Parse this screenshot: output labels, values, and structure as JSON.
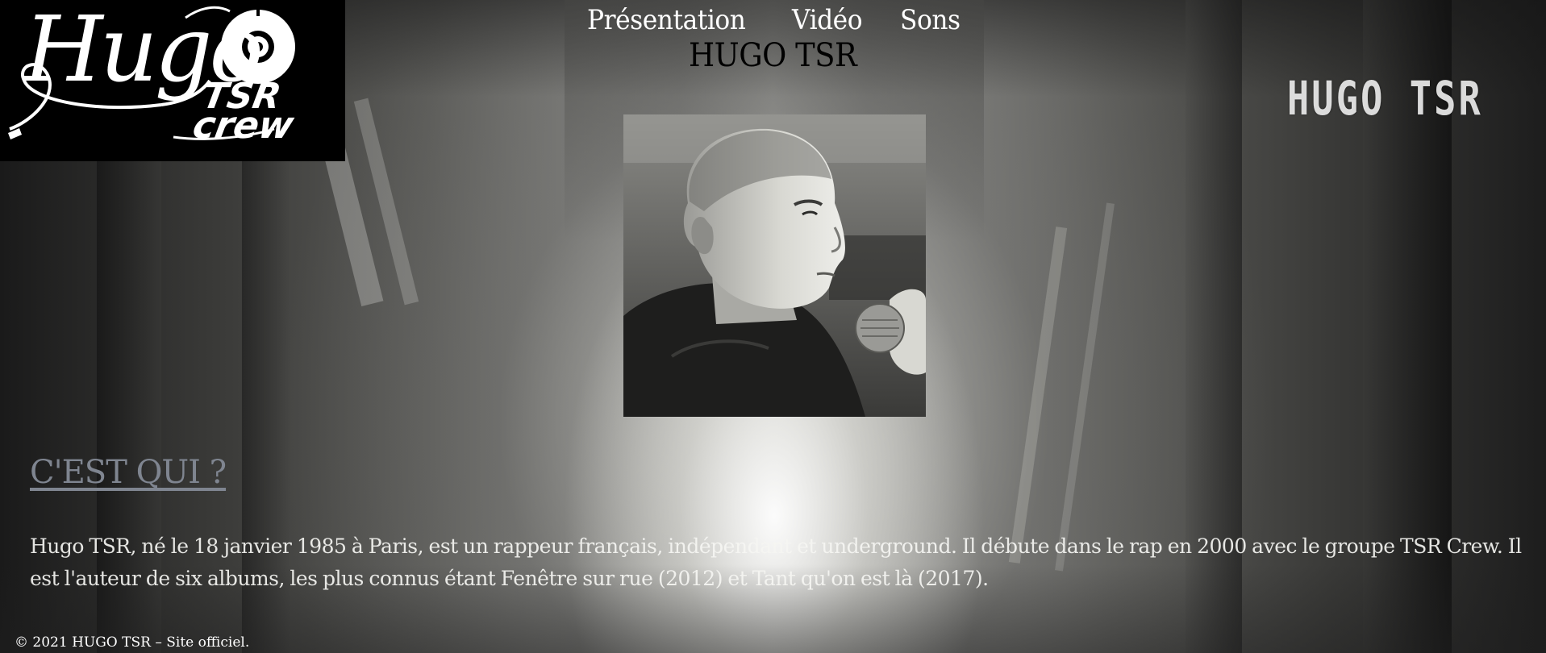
{
  "logo": {
    "line1": "Hugo",
    "line2": "TSR",
    "line3": "crew"
  },
  "nav": {
    "items": [
      {
        "label": "Présentation"
      },
      {
        "label": "Vidéo"
      },
      {
        "label": "Sons"
      }
    ]
  },
  "site_title": "HUGO TSR",
  "background_watermark": "HUGO TSR",
  "section": {
    "heading": "C'EST QUI ?",
    "text": "Hugo TSR, né le 18 janvier 1985 à Paris, est un rappeur français, indépendant et underground. Il débute dans le rap en 2000 avec le groupe TSR Crew. Il est l'auteur de six albums, les plus connus étant Fenêtre sur rue (2012) et Tant qu'on est là (2017)."
  },
  "footer": {
    "text": "© 2021 HUGO TSR – Site officiel."
  },
  "colors": {
    "heading": "#7f8590",
    "logo_bg": "#000000",
    "nav_text": "#ffffff",
    "title_text": "#000000"
  }
}
